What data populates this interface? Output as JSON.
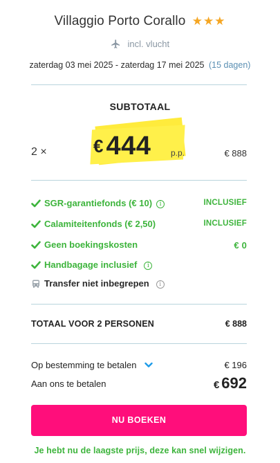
{
  "hotel": {
    "name": "Villaggio Porto Corallo",
    "stars": "★★★",
    "flight_label": "incl. vlucht",
    "dates": "zaterdag 03 mei 2025 - zaterdag 17 mei 2025",
    "duration": "(15 dagen)"
  },
  "subtotal": {
    "label": "SUBTOTAAL",
    "multiplier": "2 ×",
    "currency": "€",
    "price_per_person": "444",
    "per_person_label": "p.p.",
    "total": "€ 888"
  },
  "features": [
    {
      "label": "SGR-garantiefonds  (€ 10)",
      "value": "INCLUSIEF",
      "icon": "check-icon",
      "info": true
    },
    {
      "label": "Calamiteitenfonds  (€ 2,50)",
      "value": "INCLUSIEF",
      "icon": "check-icon",
      "info": false
    },
    {
      "label": "Geen boekingskosten",
      "value": "€ 0",
      "icon": "check-icon",
      "info": false
    },
    {
      "label": "Handbagage inclusief",
      "value": "",
      "icon": "check-icon",
      "info": true
    },
    {
      "label": "Transfer niet inbegrepen",
      "value": "",
      "icon": "bus-icon",
      "info": true
    }
  ],
  "total": {
    "label": "TOTAAL VOOR 2 PERSONEN",
    "value": "€ 888"
  },
  "payment": {
    "destination_label": "Op bestemming te betalen",
    "destination_value": "€ 196",
    "us_label": "Aan ons te betalen",
    "us_currency": "€",
    "us_value": "692"
  },
  "cta": {
    "book_label": "NU BOEKEN"
  },
  "note": "Je hebt nu de laagste prijs, deze kan snel wijzigen.",
  "colors": {
    "accent_pink": "#ff0e7b",
    "green": "#3db43c",
    "star": "#f5a623",
    "highlight": "#ffe81a",
    "link_blue": "#5a8fb3",
    "chevron_blue": "#1d9be8"
  }
}
